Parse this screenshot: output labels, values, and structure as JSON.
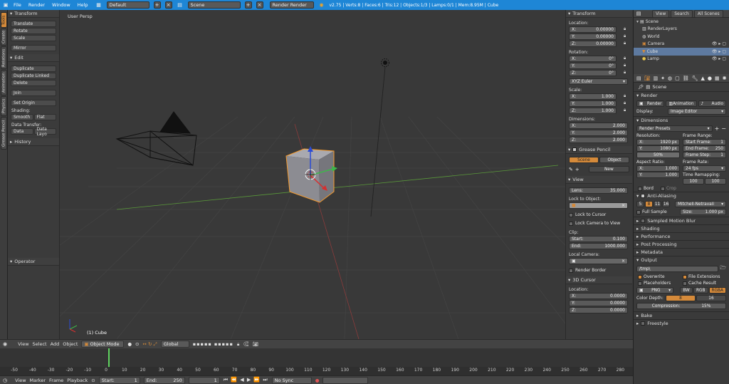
{
  "topbar": {
    "menus": [
      "File",
      "Render",
      "Window",
      "Help"
    ],
    "screen_layout": "Default",
    "scene": "Scene",
    "engine": "Render Render",
    "stats": "v2.75 | Verts:8 | Faces:6 | Tris:12 | Objects:1/3 | Lamps:0/1 | Mem:8.95M | Cube"
  },
  "left_tabs": [
    "Tools",
    "Create",
    "Relations",
    "Animation",
    "Physics",
    "Grease Pencil"
  ],
  "toolshelf": {
    "transform_title": "Transform",
    "translate": "Translate",
    "rotate": "Rotate",
    "scale": "Scale",
    "mirror": "Mirror",
    "edit_title": "Edit",
    "duplicate": "Duplicate",
    "duplicate_linked": "Duplicate Linked",
    "delete": "Delete",
    "join": "Join",
    "set_origin": "Set Origin",
    "shading_label": "Shading:",
    "smooth": "Smooth",
    "flat": "Flat",
    "data_transfer_label": "Data Transfer:",
    "data": "Data",
    "data_layout": "Data Layo",
    "history_title": "History",
    "operator_title": "Operator"
  },
  "viewport": {
    "label": "User Persp",
    "object_label": "(1) Cube"
  },
  "npanel": {
    "transform_title": "Transform",
    "location_label": "Location:",
    "loc_x": "0.00000",
    "loc_y": "0.00000",
    "loc_z": "0.00000",
    "rotation_label": "Rotation:",
    "rot_x": "0°",
    "rot_y": "0°",
    "rot_z": "0°",
    "rotation_mode": "XYZ Euler",
    "scale_label": "Scale:",
    "scale_x": "1.000",
    "scale_y": "1.000",
    "scale_z": "1.000",
    "dimensions_label": "Dimensions:",
    "dim_x": "2.000",
    "dim_y": "2.000",
    "dim_z": "2.000",
    "grease_title": "Grease Pencil",
    "gp_scene": "Scene",
    "gp_object": "Object",
    "gp_new": "New",
    "view_title": "View",
    "lens_label": "Lens:",
    "lens": "35.000",
    "lock_label": "Lock to Object:",
    "lock_cursor": "Lock to Cursor",
    "lock_camera": "Lock Camera to View",
    "clip_label": "Clip:",
    "clip_start_label": "Start:",
    "clip_start": "0.100",
    "clip_end_label": "End:",
    "clip_end": "1000.000",
    "local_camera_label": "Local Camera:",
    "render_border": "Render Border",
    "cursor_title": "3D Cursor",
    "cursor_location": "Location:",
    "cur_x": "0.0000",
    "cur_y": "0.0000",
    "cur_z": "0.0000"
  },
  "outliner": {
    "tabs": [
      "View",
      "Search",
      "All Scenes"
    ],
    "rows": [
      {
        "label": "Scene",
        "indent": 0
      },
      {
        "label": "RenderLayers",
        "indent": 1
      },
      {
        "label": "World",
        "indent": 1
      },
      {
        "label": "Camera",
        "indent": 1
      },
      {
        "label": "Cube",
        "indent": 1
      },
      {
        "label": "Lamp",
        "indent": 1
      }
    ]
  },
  "props": {
    "scene": "Scene",
    "render_title": "Render",
    "render_btn": "Render",
    "animation_btn": "Animation",
    "audio_btn": "Audio",
    "display_label": "Display:",
    "display": "Image Editor",
    "dimensions_title": "Dimensions",
    "presets": "Render Presets",
    "resolution_label": "Resolution:",
    "res_x": "1920 px",
    "res_y": "1080 px",
    "res_pct": "50%",
    "frame_range_label": "Frame Range:",
    "start_frame": "1",
    "end_frame": "250",
    "frame_step": "1",
    "start_frame_label": "Start Frame:",
    "end_frame_label": "End Frame:",
    "frame_step_label": "Frame Step:",
    "aspect_label": "Aspect Ratio:",
    "asp_x": "1.000",
    "asp_y": "1.000",
    "frame_rate_label": "Frame Rate:",
    "fps": "24 fps",
    "time_remap_label": "Time Remapping:",
    "remap_old": "100",
    "remap_new": "100",
    "border": "Bord",
    "crop": "Crop",
    "aa_title": "Anti-Aliasing",
    "aa_samples": [
      "5",
      "8",
      "11",
      "16"
    ],
    "aa_filter": "Mitchell-Netravali",
    "full_sample": "Full Sample",
    "size_label": "Size:",
    "size": "1.000 px",
    "collapsed": [
      "Sampled Motion Blur",
      "Shading",
      "Performance",
      "Post Processing",
      "Metadata"
    ],
    "output_title": "Output",
    "output_path": "/tmp\\",
    "overwrite": "Overwrite",
    "file_ext": "File Extensions",
    "placeholders": "Placeholders",
    "cache_result": "Cache Result",
    "format": "PNG",
    "bw": "BW",
    "rgb": "RGB",
    "rgba": "RGBA",
    "color_depth_label": "Color Depth:",
    "depth_8": "8",
    "depth_16": "16",
    "compression": "Compression:",
    "compression_value": "15%",
    "bake_title": "Bake",
    "freestyle_title": "Freestyle"
  },
  "viewheader": {
    "menus": [
      "View",
      "Select",
      "Add",
      "Object"
    ],
    "mode": "Object Mode",
    "orientation": "Global"
  },
  "timeline": {
    "ticks": [
      "-50",
      "-40",
      "-30",
      "-20",
      "-10",
      "0",
      "10",
      "20",
      "30",
      "40",
      "50",
      "60",
      "70",
      "80",
      "90",
      "100",
      "110",
      "120",
      "130",
      "140",
      "150",
      "160",
      "170",
      "180",
      "190",
      "200",
      "210",
      "220",
      "230",
      "240",
      "250",
      "260",
      "270",
      "280"
    ],
    "current_frame": 1
  },
  "timeheader": {
    "menus": [
      "View",
      "Marker",
      "Frame",
      "Playback"
    ],
    "start_label": "Start:",
    "start": "1",
    "end_label": "End:",
    "end": "250",
    "current": "1",
    "sync": "No Sync"
  },
  "colors": {
    "accent": "#1e86d6",
    "active_tab": "#d58a3a",
    "selection": "#5e7aa0"
  }
}
